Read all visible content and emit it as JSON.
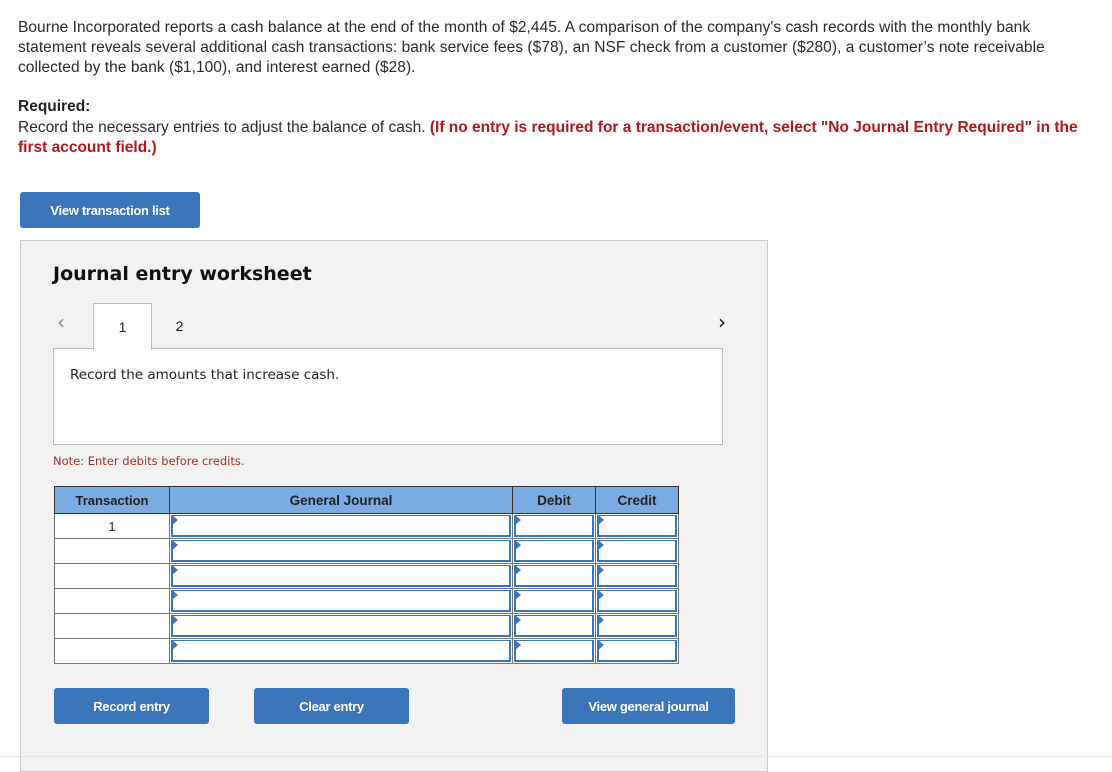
{
  "intro": {
    "text": "Bourne Incorporated reports a cash balance at the end of the month of $2,445. A comparison of the company's cash records with the monthly bank statement reveals several additional cash transactions: bank service fees ($78), an NSF check from a customer ($280), a customer’s note receivable collected by the bank ($1,100), and interest earned ($28)."
  },
  "required": {
    "label": "Required:",
    "text": "Record the necessary entries to adjust the balance of cash. ",
    "instruction": "(If no entry is required for a transaction/event, select \"No Journal Entry Required\" in the first account field.)"
  },
  "buttons": {
    "view_transaction_list": "View transaction list",
    "record_entry": "Record entry",
    "clear_entry": "Clear entry",
    "view_general_journal": "View general journal"
  },
  "worksheet": {
    "title": "Journal entry worksheet",
    "prev_icon": "‹",
    "next_icon": "›",
    "tabs": [
      {
        "label": "1",
        "active": true
      },
      {
        "label": "2",
        "active": false
      }
    ],
    "instruction": "Record the amounts that increase cash.",
    "note": "Note: Enter debits before credits.",
    "table": {
      "headers": [
        "Transaction",
        "General Journal",
        "Debit",
        "Credit"
      ],
      "rows": [
        {
          "transaction": "1",
          "account": "",
          "debit": "",
          "credit": ""
        },
        {
          "transaction": "",
          "account": "",
          "debit": "",
          "credit": ""
        },
        {
          "transaction": "",
          "account": "",
          "debit": "",
          "credit": ""
        },
        {
          "transaction": "",
          "account": "",
          "debit": "",
          "credit": ""
        },
        {
          "transaction": "",
          "account": "",
          "debit": "",
          "credit": ""
        },
        {
          "transaction": "",
          "account": "",
          "debit": "",
          "credit": ""
        }
      ]
    }
  },
  "colors": {
    "button": "#3a75ba",
    "header": "#7aace3",
    "required_red": "#b0171f",
    "note_red": "#a0302a"
  }
}
